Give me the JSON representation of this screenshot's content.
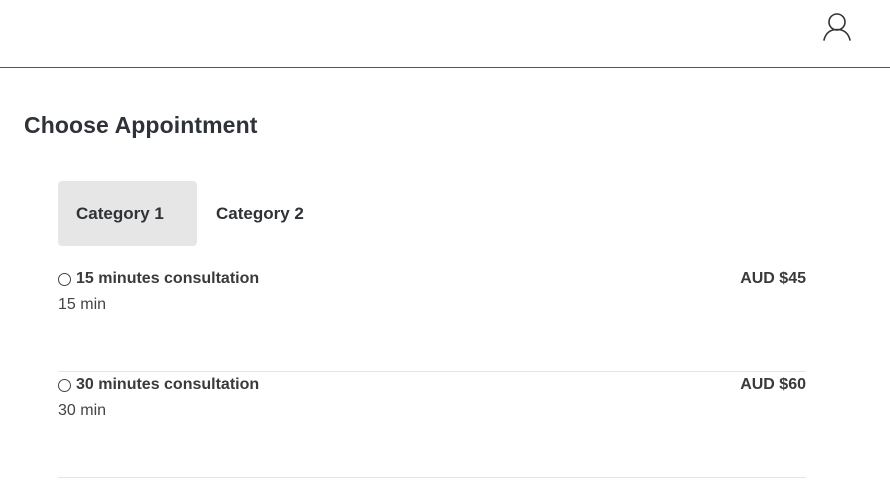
{
  "header": {
    "user_icon": "user-icon"
  },
  "page": {
    "title": "Choose Appointment"
  },
  "tabs": [
    {
      "label": "Category 1",
      "active": true
    },
    {
      "label": "Category 2",
      "active": false
    }
  ],
  "appointments": [
    {
      "name": "15 minutes consultation",
      "duration": "15 min",
      "price": "AUD $45",
      "selected": false
    },
    {
      "name": "30 minutes consultation",
      "duration": "30 min",
      "price": "AUD $60",
      "selected": false
    }
  ],
  "colors": {
    "active_tab_bg": "#e6e6e6",
    "divider": "#e5e5e5",
    "header_border": "#555555"
  }
}
